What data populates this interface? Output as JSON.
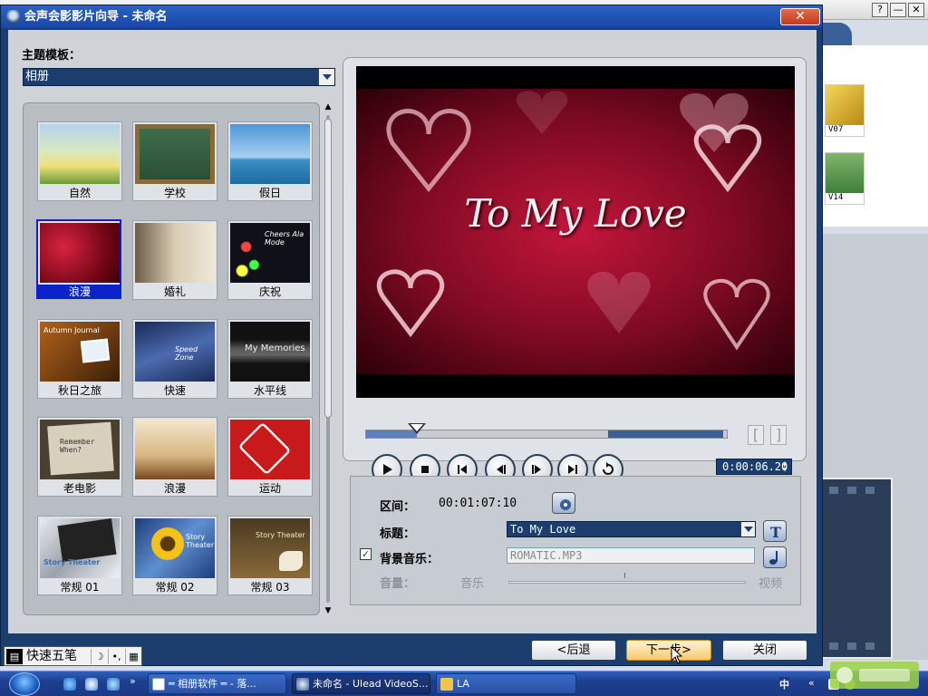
{
  "background_window": {
    "help_btn": "?",
    "min_btn": "—",
    "close_btn": "✕",
    "library_items": [
      {
        "label": "V07"
      },
      {
        "label": "V14"
      }
    ]
  },
  "dialog": {
    "title": "会声会影影片向导 - 未命名",
    "close_glyph": "✕",
    "template_label": "主题模板：",
    "template_selected": "相册",
    "templates": [
      {
        "label": "自然"
      },
      {
        "label": "学校"
      },
      {
        "label": "假日"
      },
      {
        "label": "浪漫",
        "selected": true
      },
      {
        "label": "婚礼"
      },
      {
        "label": "庆祝"
      },
      {
        "label": "秋日之旅"
      },
      {
        "label": "快速"
      },
      {
        "label": "水平线"
      },
      {
        "label": "老电影"
      },
      {
        "label": "浪漫"
      },
      {
        "label": "运动"
      },
      {
        "label": "常规 01"
      },
      {
        "label": "常规 02"
      },
      {
        "label": "常规 03"
      }
    ],
    "thumb_texts": {
      "autumn": "Autumn Journal",
      "speed": "Speed Zone",
      "memories": "My Memories",
      "remember": "Remember When?",
      "cheers": "Cheers Ala Mode",
      "story1": "Story Theater",
      "story2": "Story Theater",
      "story3": "Story Theater"
    },
    "preview": {
      "overlay_text": "To My Love",
      "timecode": "0:00:06.20",
      "progress": 0.14,
      "trim_start": 0.67,
      "trim_end": 0.99,
      "trim_left": "[",
      "trim_right": "]"
    },
    "settings": {
      "duration_label": "区间：",
      "duration_value": "00:01:07:10",
      "title_label": "标题：",
      "title_value": "To My Love",
      "music_label": "背景音乐：",
      "music_checked": true,
      "music_file": "ROMATIC.MP3",
      "volume_label": "音量：",
      "volume_left": "音乐",
      "volume_right": "视频",
      "volume_balance": 0.49
    },
    "buttons": {
      "back": "<后退",
      "next": "下一步>",
      "close": "关闭"
    }
  },
  "ime": {
    "name": "快速五笔"
  },
  "taskbar": {
    "tasks": [
      {
        "label": "═ 相册软件 ═ - 落...",
        "active": false
      },
      {
        "label": "未命名 - Ulead VideoS...",
        "active": true
      },
      {
        "label": "LA",
        "active": false
      }
    ],
    "tray_ime": "中",
    "tray_arrow": "«"
  }
}
